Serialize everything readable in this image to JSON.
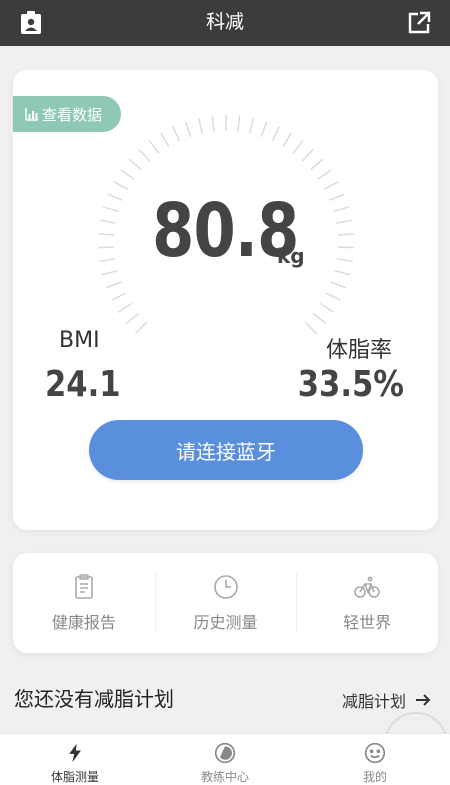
{
  "header": {
    "title": "科减"
  },
  "main": {
    "data_tag": "查看数据",
    "weight_value": "80.8",
    "weight_unit": "kg",
    "bmi_label": "BMI",
    "bmi_value": "24.1",
    "fat_label": "体脂率",
    "fat_value": "33.5%",
    "bluetooth_button": "请连接蓝牙"
  },
  "menu": [
    {
      "label": "健康报告",
      "icon": "clipboard-icon"
    },
    {
      "label": "历史测量",
      "icon": "clock-icon"
    },
    {
      "label": "轻世界",
      "icon": "bicycle-icon"
    }
  ],
  "plan": {
    "title": "您还没有减脂计划",
    "link": "减脂计划"
  },
  "tabs": [
    {
      "label": "体脂测量",
      "icon": "lightning-icon",
      "active": true
    },
    {
      "label": "教练中心",
      "icon": "circle-icon",
      "active": false
    },
    {
      "label": "我的",
      "icon": "smiley-icon",
      "active": false
    }
  ],
  "colors": {
    "topbar": "#3c3c3c",
    "accent_blue": "#5a8fde",
    "tag_green": "#8fc9b3"
  }
}
